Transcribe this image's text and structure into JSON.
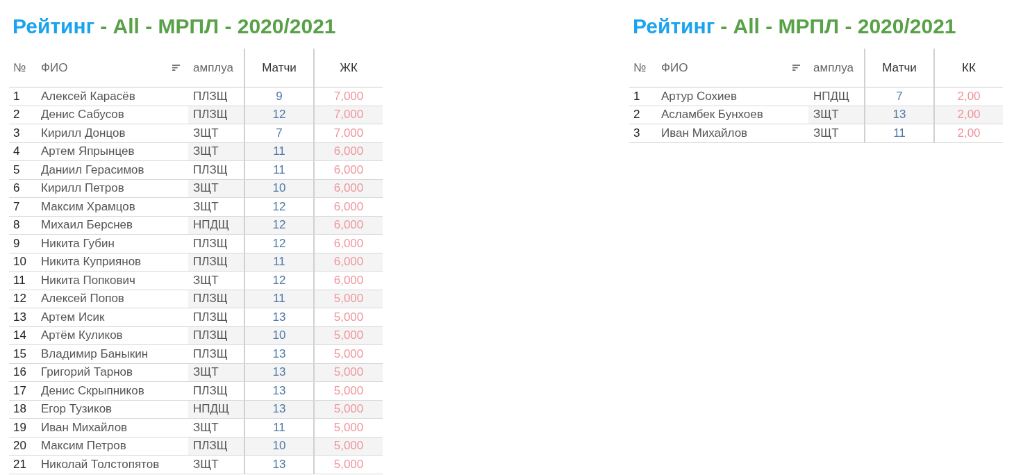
{
  "tables": [
    {
      "title": {
        "main": "Рейтинг",
        "rest": "- All - МРПЛ - 2020/2021"
      },
      "columns": [
        "№",
        "ФИО",
        "амплуа",
        "Матчи",
        "ЖК"
      ],
      "rows": [
        [
          "1",
          "Алексей Карасёв",
          "ПЛЗЩ",
          "9",
          "7,000"
        ],
        [
          "2",
          "Денис Сабусов",
          "ПЛЗЩ",
          "12",
          "7,000"
        ],
        [
          "3",
          "Кирилл Донцов",
          "ЗЩТ",
          "7",
          "7,000"
        ],
        [
          "4",
          "Артем Япрынцев",
          "ЗЩТ",
          "11",
          "6,000"
        ],
        [
          "5",
          "Даниил Герасимов",
          "ПЛЗЩ",
          "11",
          "6,000"
        ],
        [
          "6",
          "Кирилл Петров",
          "ЗЩТ",
          "10",
          "6,000"
        ],
        [
          "7",
          "Максим Храмцов",
          "ЗЩТ",
          "12",
          "6,000"
        ],
        [
          "8",
          "Михаил Берснев",
          "НПДЩ",
          "12",
          "6,000"
        ],
        [
          "9",
          "Никита Губин",
          "ПЛЗЩ",
          "12",
          "6,000"
        ],
        [
          "10",
          "Никита Куприянов",
          "ПЛЗЩ",
          "11",
          "6,000"
        ],
        [
          "11",
          "Никита Попкович",
          "ЗЩТ",
          "12",
          "6,000"
        ],
        [
          "12",
          "Алексей Попов",
          "ПЛЗЩ",
          "11",
          "5,000"
        ],
        [
          "13",
          "Артем Исик",
          "ПЛЗЩ",
          "13",
          "5,000"
        ],
        [
          "14",
          "Артём Куликов",
          "ПЛЗЩ",
          "10",
          "5,000"
        ],
        [
          "15",
          "Владимир Баныкин",
          "ПЛЗЩ",
          "13",
          "5,000"
        ],
        [
          "16",
          "Григорий Тарнов",
          "ЗЩТ",
          "13",
          "5,000"
        ],
        [
          "17",
          "Денис Скрыпников",
          "ПЛЗЩ",
          "13",
          "5,000"
        ],
        [
          "18",
          "Егор Тузиков",
          "НПДЩ",
          "13",
          "5,000"
        ],
        [
          "19",
          "Иван Михайлов",
          "ЗЩТ",
          "11",
          "5,000"
        ],
        [
          "20",
          "Максим Петров",
          "ПЛЗЩ",
          "10",
          "5,000"
        ],
        [
          "21",
          "Николай Толстопятов",
          "ЗЩТ",
          "13",
          "5,000"
        ]
      ]
    },
    {
      "title": {
        "main": "Рейтинг",
        "rest": "- All - МРПЛ - 2020/2021"
      },
      "columns": [
        "№",
        "ФИО",
        "амплуа",
        "Матчи",
        "КК"
      ],
      "rows": [
        [
          "1",
          "Артур Сохиев",
          "НПДЩ",
          "7",
          "2,00"
        ],
        [
          "2",
          "Асламбек Бунхоев",
          "ЗЩТ",
          "13",
          "2,00"
        ],
        [
          "3",
          "Иван Михайлов",
          "ЗЩТ",
          "11",
          "2,00"
        ]
      ]
    }
  ]
}
